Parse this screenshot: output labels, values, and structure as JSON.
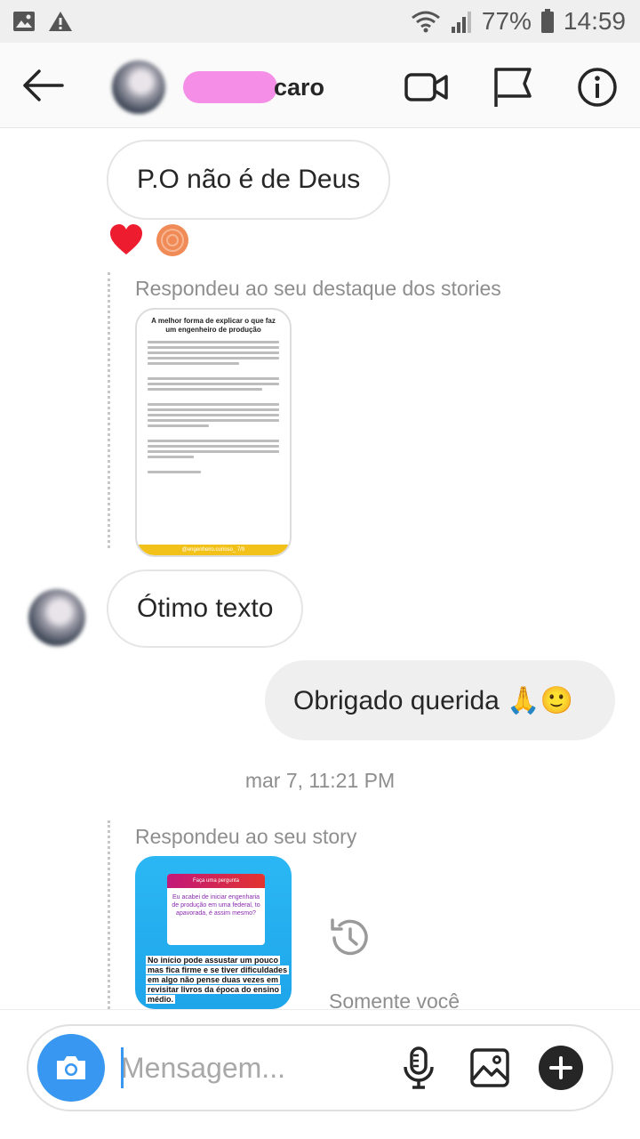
{
  "status_bar": {
    "battery": "77%",
    "time": "14:59"
  },
  "header": {
    "username_visible": "caro"
  },
  "messages": {
    "msg1": "P.O não é de Deus",
    "reply1_caption": "Respondeu ao seu destaque dos stories",
    "msg2": "Ótimo texto",
    "msg3": "Obrigado querida 🙏🙂",
    "timestamp": "mar 7, 11:21 PM",
    "reply2_caption": "Respondeu ao seu story",
    "only_you": "Somente você"
  },
  "story1": {
    "title": "A melhor forma de explicar o que faz um engenheiro de produção",
    "footer": "@engenheiro.curioso_   7/9"
  },
  "story2": {
    "question_header": "Faça uma pergunta",
    "question": "Eu acabei de iniciar engenharia de produção em uma federal, to apavorada, é assim mesmo?",
    "answer": "No início pode assustar um pouco mas fica firme e se tiver dificuldades em algo não pense duas vezes em revisitar livros da época do ensino médio."
  },
  "composer": {
    "placeholder": "Mensagem..."
  },
  "icons": {
    "status_left": [
      "image-icon",
      "warning-icon"
    ],
    "status_right": [
      "wifi-icon",
      "signal-icon",
      "battery-icon"
    ],
    "header": [
      "back-arrow-icon",
      "video-call-icon",
      "flag-icon",
      "info-icon"
    ],
    "composer": [
      "camera-icon",
      "microphone-icon",
      "gallery-icon",
      "plus-icon"
    ],
    "reactions": [
      "heart-icon",
      "sticker-icon"
    ],
    "history": "history-icon"
  },
  "colors": {
    "accent": "#3897f0",
    "redaction": "#f48ee6",
    "heart": "#ed1c2e",
    "story_blue": "#2bb7f4",
    "story_yellow": "#f3c21a"
  }
}
